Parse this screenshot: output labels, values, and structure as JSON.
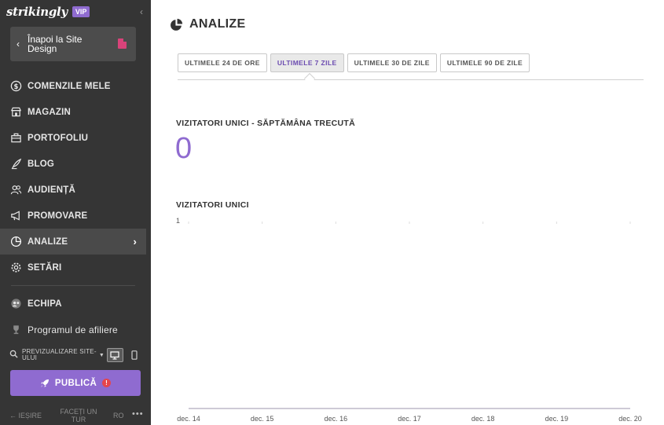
{
  "sidebar": {
    "brand": "strikingly",
    "vip": "VIP",
    "back_label": "Înapoi la Site Design",
    "items": [
      {
        "label": "COMENZILE MELE",
        "icon": "dollar-circle-icon"
      },
      {
        "label": "MAGAZIN",
        "icon": "store-icon"
      },
      {
        "label": "PORTOFOLIU",
        "icon": "briefcase-icon"
      },
      {
        "label": "BLOG",
        "icon": "quill-icon"
      },
      {
        "label": "AUDIENȚĂ",
        "icon": "people-icon"
      },
      {
        "label": "PROMOVARE",
        "icon": "megaphone-icon"
      },
      {
        "label": "ANALIZE",
        "icon": "pie-chart-icon",
        "active": true
      },
      {
        "label": "SETĂRI",
        "icon": "gear-icon"
      }
    ],
    "team_label": "ECHIPA",
    "affiliate_label": "Programul de afiliere",
    "preview_label": "PREVIZUALIZARE SITE-ULUI",
    "publish_label": "PUBLICĂ",
    "publish_badge": "!",
    "footer": {
      "exit": "IEȘIRE",
      "tour": "FACEȚI UN TUR",
      "lang": "RO",
      "more": "•••"
    }
  },
  "main": {
    "title": "ANALIZE",
    "tabs": [
      {
        "label": "ULTIMELE 24 DE ORE"
      },
      {
        "label": "ULTIMELE 7 ZILE",
        "active": true
      },
      {
        "label": "ULTIMELE 30 DE ZILE"
      },
      {
        "label": "ULTIMELE 90 DE ZILE"
      }
    ],
    "stat_label": "VIZITATORI UNICI - SĂPTĂMÂNA TRECUTĂ",
    "stat_value": "0",
    "chart_title": "VIZITATORI UNICI"
  },
  "colors": {
    "accent": "#8f6bd0",
    "sidebar_bg": "#353535",
    "badge": "#e5454c"
  },
  "chart_data": {
    "type": "line",
    "title": "VIZITATORI UNICI",
    "x": [
      "dec. 14",
      "dec. 15",
      "dec. 16",
      "dec. 17",
      "dec. 18",
      "dec. 19",
      "dec. 20"
    ],
    "series": [
      {
        "values": [
          0,
          0,
          0,
          0,
          0,
          0,
          0
        ]
      }
    ],
    "ylim": [
      0,
      1
    ],
    "y_ticks": [
      "1"
    ],
    "grid": true
  }
}
